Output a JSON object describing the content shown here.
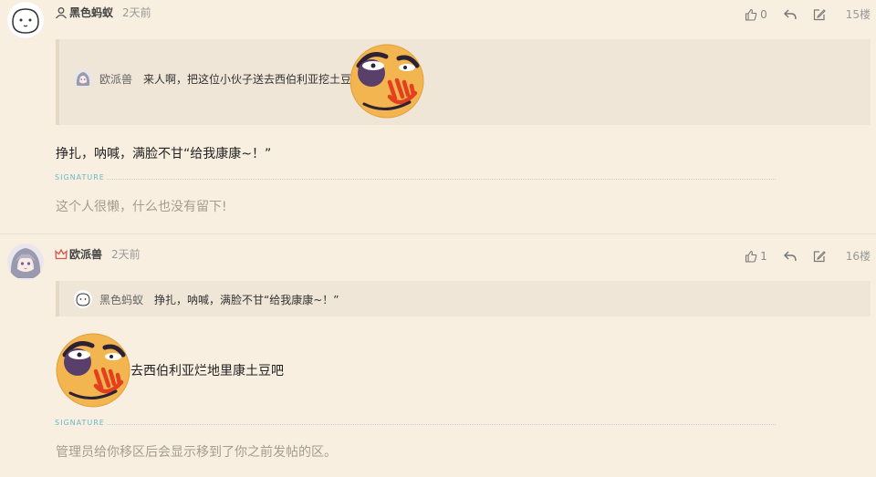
{
  "posts": [
    {
      "username": "黑色蚂蚁",
      "time": "2天前",
      "likes": "0",
      "floor": "15楼",
      "quote": {
        "username": "欧派兽",
        "text": "来人啊，把这位小伙子送去西伯利亚挖土豆"
      },
      "content": "挣扎，呐喊，满脸不甘“给我康康~！”",
      "signature_label": "SIGNATURE",
      "signature": "这个人很懒，什么也没有留下!"
    },
    {
      "username": "欧派兽",
      "time": "2天前",
      "likes": "1",
      "floor": "16楼",
      "quote": {
        "username": "黑色蚂蚁",
        "text": "挣扎，呐喊，满脸不甘“给我康康~！”"
      },
      "content": "去西伯利亚烂地里康土豆吧",
      "signature_label": "SIGNATURE",
      "signature": "管理员给你移区后会显示移到了你之前发帖的区。"
    }
  ],
  "colors": {
    "background": "#f8efe0",
    "quote_bg": "#efe6d7",
    "signature_label": "#6bb6c9",
    "signature_text": "#a59c90"
  },
  "icons": [
    "user-icon",
    "crown-icon",
    "thumb-up-icon",
    "reply-icon",
    "edit-icon",
    "angry-emoji"
  ]
}
